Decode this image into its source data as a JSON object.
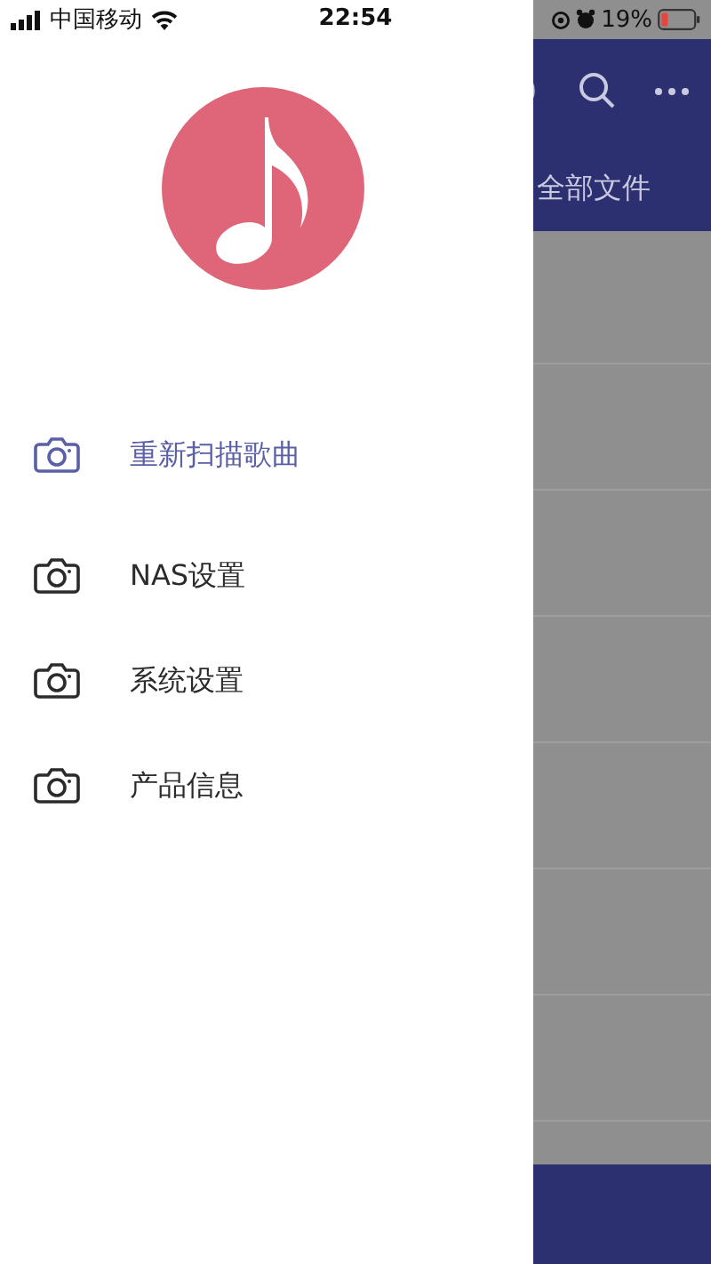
{
  "status_bar": {
    "carrier": "中国移动",
    "time": "22:54",
    "battery": "19%"
  },
  "drawer": {
    "menu": [
      {
        "label": "重新扫描歌曲",
        "selected": true
      },
      {
        "label": "NAS设置",
        "selected": false
      },
      {
        "label": "系统设置",
        "selected": false
      },
      {
        "label": "产品信息",
        "selected": false
      }
    ]
  },
  "main": {
    "title": "全部文件"
  }
}
